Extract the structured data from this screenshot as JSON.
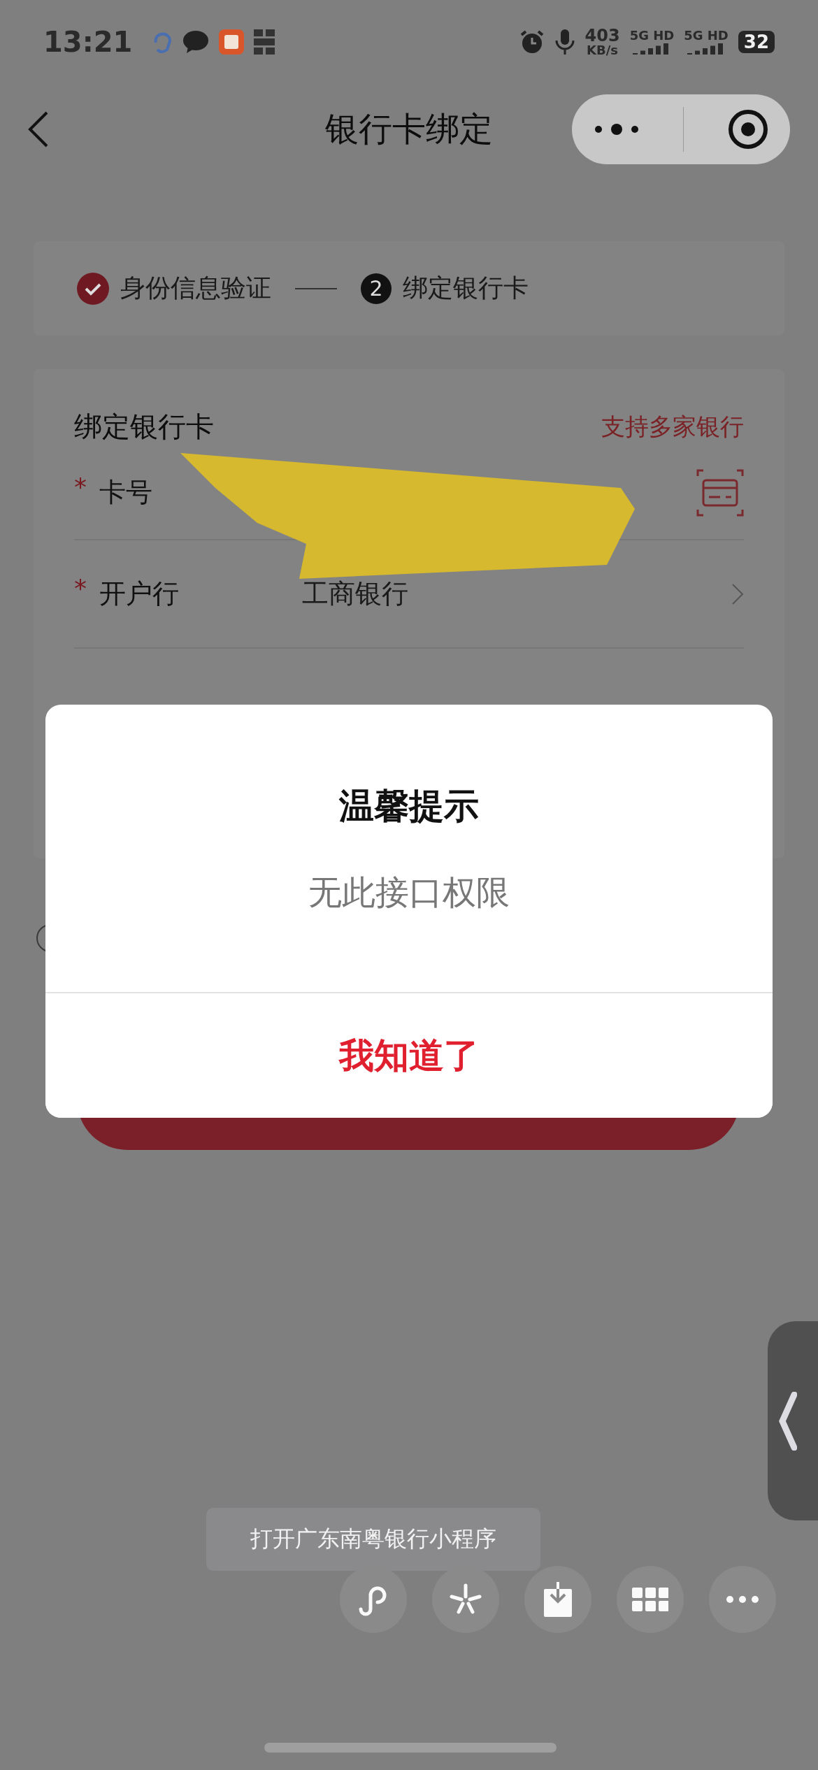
{
  "status_bar": {
    "time": "13:21",
    "net_speed": "403",
    "net_unit": "KB/s",
    "sim_labels": [
      "5G HD",
      "5G HD"
    ],
    "battery": "32"
  },
  "nav": {
    "title": "银行卡绑定"
  },
  "steps": [
    {
      "label": "身份信息验证",
      "done": true
    },
    {
      "label": "绑定银行卡",
      "number": "2",
      "done": false
    }
  ],
  "form": {
    "title": "绑定银行卡",
    "link": "支持多家银行",
    "fields": [
      {
        "label": "卡号",
        "required_mark": "*",
        "kind": "card"
      },
      {
        "label": "开户行",
        "required_mark": "*",
        "value": "工商银行",
        "kind": "select"
      }
    ]
  },
  "dialog": {
    "title": "温馨提示",
    "message": "无此接口权限",
    "button": "我知道了"
  },
  "tooltip": "打开广东南粤银行小程序"
}
